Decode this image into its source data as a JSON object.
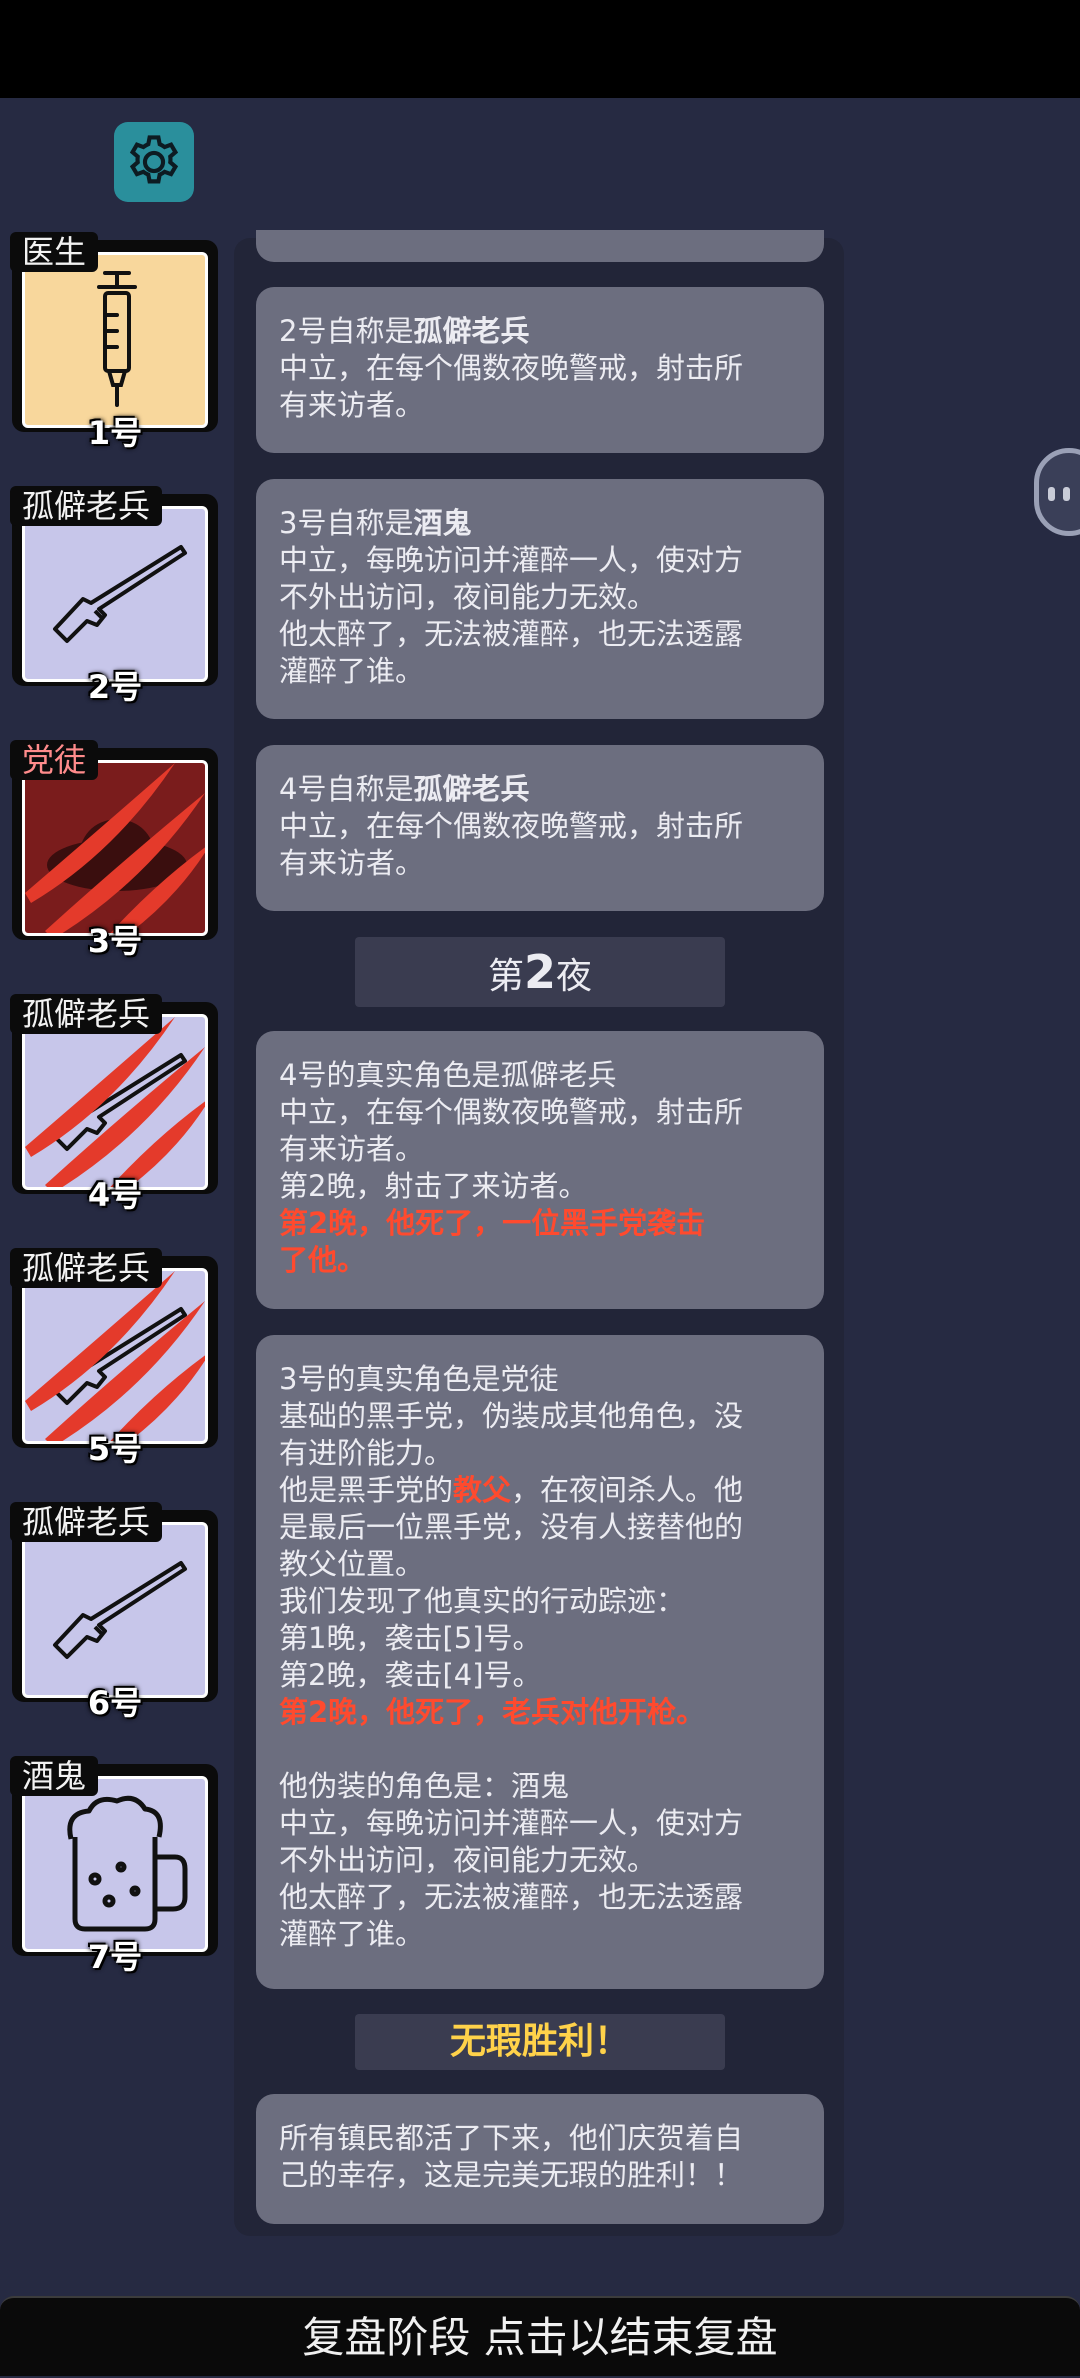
{
  "players": [
    {
      "role": "医生",
      "seat": "1号",
      "icon": "syringe-icon",
      "dead": false,
      "mafia": false
    },
    {
      "role": "孤僻老兵",
      "seat": "2号",
      "icon": "rifle-icon",
      "dead": false,
      "mafia": false
    },
    {
      "role": "党徒",
      "seat": "3号",
      "icon": "fedora-hat-icon",
      "dead": true,
      "mafia": true
    },
    {
      "role": "孤僻老兵",
      "seat": "4号",
      "icon": "rifle-icon",
      "dead": true,
      "mafia": false
    },
    {
      "role": "孤僻老兵",
      "seat": "5号",
      "icon": "rifle-icon",
      "dead": true,
      "mafia": false
    },
    {
      "role": "孤僻老兵",
      "seat": "6号",
      "icon": "rifle-icon",
      "dead": false,
      "mafia": false
    },
    {
      "role": "酒鬼",
      "seat": "7号",
      "icon": "beer-mug-icon",
      "dead": false,
      "mafia": false
    }
  ],
  "log": {
    "claim2": {
      "prefix": "2号自称是",
      "role": "孤僻老兵",
      "desc1": "中立，在每个偶数夜晚警戒，射击所",
      "desc2": "有来访者。"
    },
    "claim3": {
      "prefix": "3号自称是",
      "role": "酒鬼",
      "desc1": "中立，每晚访问并灌醉一人，使对方",
      "desc2": "不外出访问，夜间能力无效。",
      "desc3": "他太醉了，无法被灌醉，也无法透露",
      "desc4": "灌醉了谁。"
    },
    "claim4": {
      "prefix": "4号自称是",
      "role": "孤僻老兵",
      "desc1": "中立，在每个偶数夜晚警戒，射击所",
      "desc2": "有来访者。"
    },
    "night2": {
      "pre": "第",
      "num": "2",
      "post": "夜"
    },
    "reveal4": {
      "l1": "4号的真实角色是孤僻老兵",
      "l2": "中立，在每个偶数夜晚警戒，射击所",
      "l3": "有来访者。",
      "l4": "第2晚，射击了来访者。",
      "death1": "第2晚，他死了，一位黑手党袭击",
      "death2": "了他。"
    },
    "reveal3": {
      "l1": "3号的真实角色是党徒",
      "l2": "基础的黑手党，伪装成其他角色，没",
      "l3": "有进阶能力。",
      "l4a": "他是黑手党的",
      "l4b": "教父",
      "l4c": "，在夜间杀人。他",
      "l5": "是最后一位黑手党，没有人接替他的",
      "l6": "教父位置。",
      "l7": "我们发现了他真实的行动踪迹：",
      "l8": "第1晚，袭击[5]号。",
      "l9": "第2晚，袭击[4]号。",
      "death": "第2晚，他死了，老兵对他开枪。",
      "fake1": "他伪装的角色是：酒鬼",
      "fake2": "中立，每晚访问并灌醉一人，使对方",
      "fake3": "不外出访问，夜间能力无效。",
      "fake4": "他太醉了，无法被灌醉，也无法透露",
      "fake5": "灌醉了谁。"
    },
    "victory_title": "无瑕胜利！",
    "victory1": "所有镇民都活了下来，他们庆贺着自",
    "victory2": "己的幸存，这是完美无瑕的胜利！！"
  },
  "bottom_button": "复盘阶段 点击以结束复盘",
  "colors": {
    "background": "#262a42",
    "card_bg_doctor": "#f8d79c",
    "card_bg_default": "#c7c6ea",
    "card_bg_mafia": "#7a1c1c",
    "death_text": "#ff4a2e",
    "victory_text": "#ffd24a",
    "settings": "#2a8f9c"
  }
}
